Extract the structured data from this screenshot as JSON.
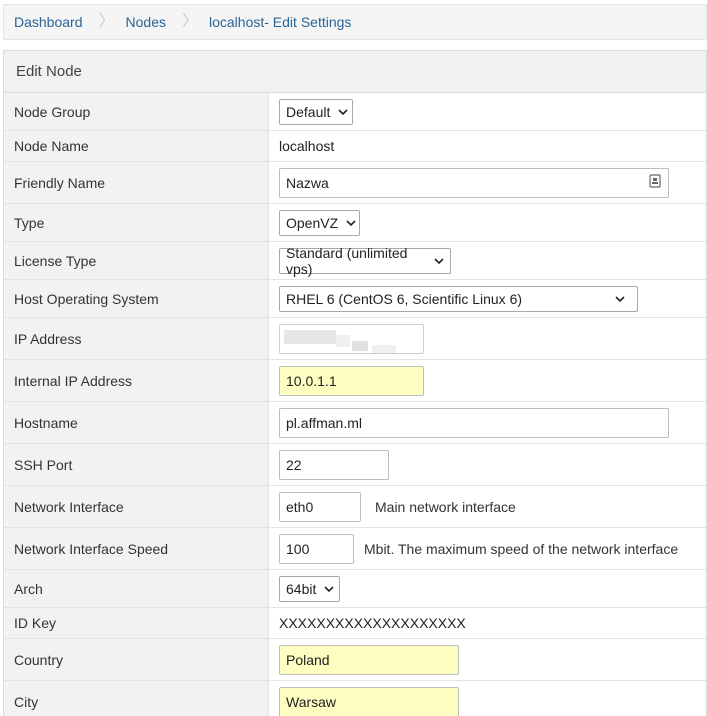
{
  "breadcrumb": {
    "dashboard": "Dashboard",
    "nodes": "Nodes",
    "current": "localhost- Edit Settings"
  },
  "panel": {
    "title": "Edit Node"
  },
  "rows": {
    "node_group": {
      "label": "Node Group",
      "value": "Default"
    },
    "node_name": {
      "label": "Node Name",
      "value": "localhost"
    },
    "friendly_name": {
      "label": "Friendly Name",
      "value": "Nazwa"
    },
    "type": {
      "label": "Type",
      "value": "OpenVZ"
    },
    "license_type": {
      "label": "License Type",
      "value": "Standard (unlimited vps)"
    },
    "host_os": {
      "label": "Host Operating System",
      "value": "RHEL 6 (CentOS 6, Scientific Linux 6)"
    },
    "ip_address": {
      "label": "IP Address",
      "value": ""
    },
    "internal_ip": {
      "label": "Internal IP Address",
      "value": "10.0.1.1"
    },
    "hostname": {
      "label": "Hostname",
      "value": "pl.affman.ml"
    },
    "ssh_port": {
      "label": "SSH Port",
      "value": "22"
    },
    "net_iface": {
      "label": "Network Interface",
      "value": "eth0",
      "hint": "Main network interface"
    },
    "net_speed": {
      "label": "Network Interface Speed",
      "value": "100",
      "hint": "Mbit. The maximum speed of the network interface"
    },
    "arch": {
      "label": "Arch",
      "value": "64bit"
    },
    "id_key": {
      "label": "ID Key",
      "value": "XXXXXXXXXXXXXXXXXXXX"
    },
    "country": {
      "label": "Country",
      "value": "Poland"
    },
    "city": {
      "label": "City",
      "value": "Warsaw"
    }
  },
  "colors": {
    "link": "#2a6496",
    "highlight_field": "#fefec0",
    "label_bg": "#f2f2f2"
  },
  "icons": {
    "select_arrow": "chevron-down-icon",
    "field_badge": "contact-card-icon"
  }
}
